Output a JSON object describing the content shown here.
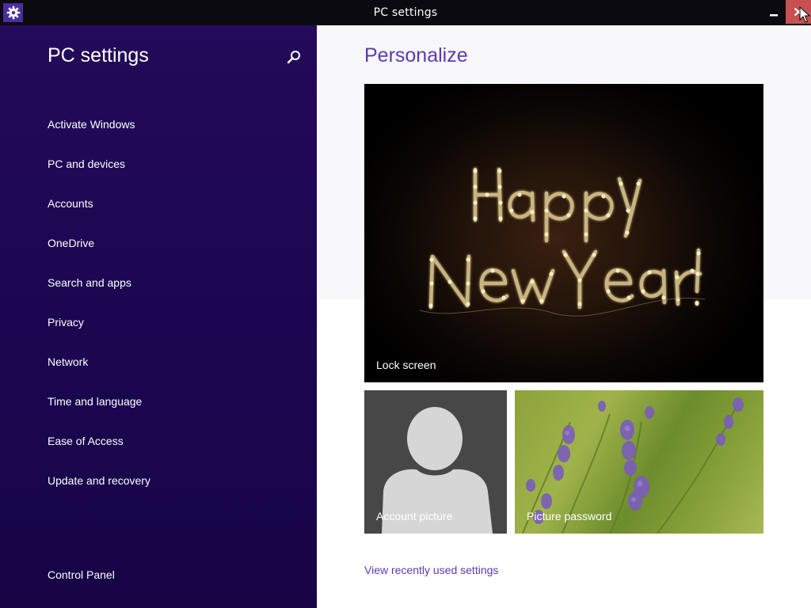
{
  "window": {
    "title": "PC settings",
    "close_color": "#c75050",
    "icons": {
      "app": "gear-icon",
      "minimize": "minimize-icon",
      "close": "close-icon"
    }
  },
  "sidebar": {
    "title": "PC settings",
    "search_icon": "search-icon",
    "background": "#1b0650",
    "items": [
      {
        "label": "Activate Windows"
      },
      {
        "label": "PC and devices"
      },
      {
        "label": "Accounts"
      },
      {
        "label": "OneDrive"
      },
      {
        "label": "Search and apps"
      },
      {
        "label": "Privacy"
      },
      {
        "label": "Network"
      },
      {
        "label": "Time and language"
      },
      {
        "label": "Ease of Access"
      },
      {
        "label": "Update and recovery"
      }
    ],
    "control_panel": "Control Panel"
  },
  "main": {
    "title": "Personalize",
    "accent": "#5a39b4",
    "tiles": {
      "lock_screen": {
        "label": "Lock screen"
      },
      "account_picture": {
        "label": "Account picture"
      },
      "picture_password": {
        "label": "Picture password"
      }
    },
    "view_recent": "View recently used settings"
  }
}
